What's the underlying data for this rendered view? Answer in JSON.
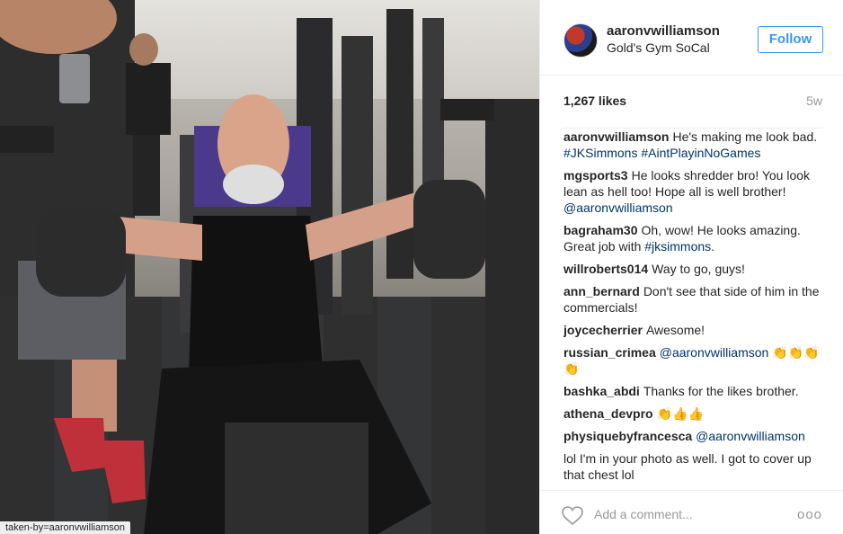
{
  "post": {
    "photo_tag": "taken-by=aaronvwilliamson",
    "header": {
      "username": "aaronvwilliamson",
      "location": "Gold's Gym SoCal",
      "follow_label": "Follow"
    },
    "likes": "1,267 likes",
    "age": "5w",
    "comments": [
      {
        "author": "aaronvwilliamson",
        "text": "He's making me look bad.",
        "link": "#JKSimmons #AintPlayinNoGames"
      },
      {
        "author": "mgsports3",
        "text": "He looks shredder bro! You look lean as hell too! Hope all is well brother!",
        "link": "@aaronvwilliamson"
      },
      {
        "author": "bagraham30",
        "text": "Oh, wow! He looks amazing. Great job with",
        "link": "#jksimmons."
      },
      {
        "author": "willroberts014",
        "text": "Way to go, guys!",
        "link": ""
      },
      {
        "author": "ann_bernard",
        "text": "Don't see that side of him in the commercials!",
        "link": ""
      },
      {
        "author": "joycecherrier",
        "text": "Awesome!",
        "link": ""
      },
      {
        "author": "russian_crimea",
        "text": "",
        "link": "@aaronvwilliamson 👏👏👏👏"
      },
      {
        "author": "bashka_abdi",
        "text": "Thanks for the likes brother.",
        "link": ""
      },
      {
        "author": "athena_devpro",
        "text": "👏👍👍",
        "link": ""
      },
      {
        "author": "physiquebyfrancesca",
        "text": "",
        "link": "@aaronvwilliamson"
      },
      {
        "author": "",
        "text": "lol I'm in your photo as well. I got to cover up that chest lol",
        "link": ""
      }
    ],
    "footer": {
      "add_comment_placeholder": "Add a comment...",
      "more_label": "ooo"
    }
  },
  "colors": {
    "accent": "#3897f0",
    "link": "#003569",
    "muted": "#999999",
    "border": "#efefef"
  },
  "icons": {
    "heart": "heart-icon",
    "more": "more-options-icon"
  }
}
